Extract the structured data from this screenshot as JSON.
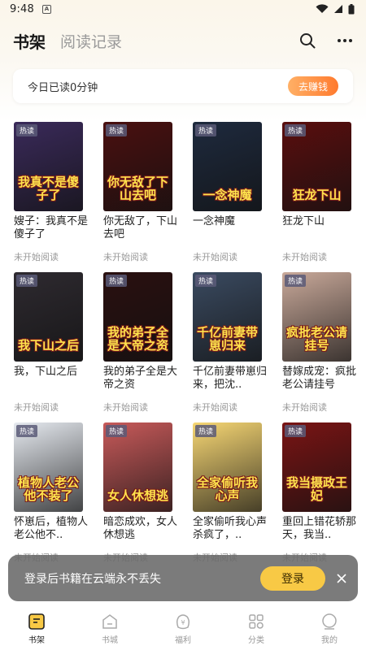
{
  "status_bar": {
    "time": "9:48",
    "notification_letter": "A"
  },
  "header": {
    "tab_active": "书架",
    "tab_inactive": "阅读记录"
  },
  "reading": {
    "text": "今日已读0分钟",
    "earn_button": "去赚钱"
  },
  "books": [
    {
      "title": "嫂子：我真不是傻子了",
      "status": "未开始阅读",
      "badge": "热读",
      "cover_text": "我真不是傻子了",
      "cover_bg": "#3a2a5a"
    },
    {
      "title": "你无敌了，下山去吧",
      "status": "未开始阅读",
      "badge": "热读",
      "cover_text": "你无敌了下山去吧",
      "cover_bg": "#4a1010"
    },
    {
      "title": "一念神魔",
      "status": "未开始阅读",
      "badge": "热读",
      "cover_text": "一念神魔",
      "cover_bg": "#1e2a3e"
    },
    {
      "title": "狂龙下山",
      "status": "未开始阅读",
      "badge": "热读",
      "cover_text": "狂龙下山",
      "cover_bg": "#5a0e0e"
    },
    {
      "title": "我，下山之后",
      "status": "未开始阅读",
      "badge": "热读",
      "cover_text": "我下山之后",
      "cover_bg": "#2e2a30"
    },
    {
      "title": "我的弟子全是大帝之资",
      "status": "未开始阅读",
      "badge": "热读",
      "cover_text": "我的弟子全是大帝之资",
      "cover_bg": "#2a1010"
    },
    {
      "title": "千亿前妻带崽归来，把沈..",
      "status": "未开始阅读",
      "badge": "热读",
      "cover_text": "千亿前妻带崽归来",
      "cover_bg": "#3a4a60"
    },
    {
      "title": "替嫁成宠：疯批老公请挂号",
      "status": "未开始阅读",
      "badge": "热读",
      "cover_text": "疯批老公请挂号",
      "cover_bg": "#c9a99a"
    },
    {
      "title": "怀崽后，植物人老公他不..",
      "status": "未开始阅读",
      "badge": "热读",
      "cover_text": "植物人老公他不装了",
      "cover_bg": "#e6eaf0"
    },
    {
      "title": "暗恋成欢，女人休想逃",
      "status": "未开始阅读",
      "badge": "热读",
      "cover_text": "女人休想逃",
      "cover_bg": "#c85a5a"
    },
    {
      "title": "全家偷听我心声杀疯了，..",
      "status": "未开始阅读",
      "badge": "热读",
      "cover_text": "全家偷听我心声",
      "cover_bg": "#f7d774"
    },
    {
      "title": "重回上错花轿那天，我当..",
      "status": "未开始阅读",
      "badge": "热读",
      "cover_text": "我当摄政王妃",
      "cover_bg": "#7a1414"
    }
  ],
  "toast": {
    "message": "登录后书籍在云端永不丢失",
    "login_button": "登录"
  },
  "bottom_nav": [
    {
      "label": "书架",
      "icon": "bookshelf-icon",
      "active": true
    },
    {
      "label": "书城",
      "icon": "bookstore-icon",
      "active": false
    },
    {
      "label": "福利",
      "icon": "welfare-icon",
      "active": false
    },
    {
      "label": "分类",
      "icon": "category-icon",
      "active": false
    },
    {
      "label": "我的",
      "icon": "profile-icon",
      "active": false
    }
  ],
  "colors": {
    "accent": "#ff7a2e",
    "login_yellow": "#f8c945",
    "muted": "#999999"
  }
}
